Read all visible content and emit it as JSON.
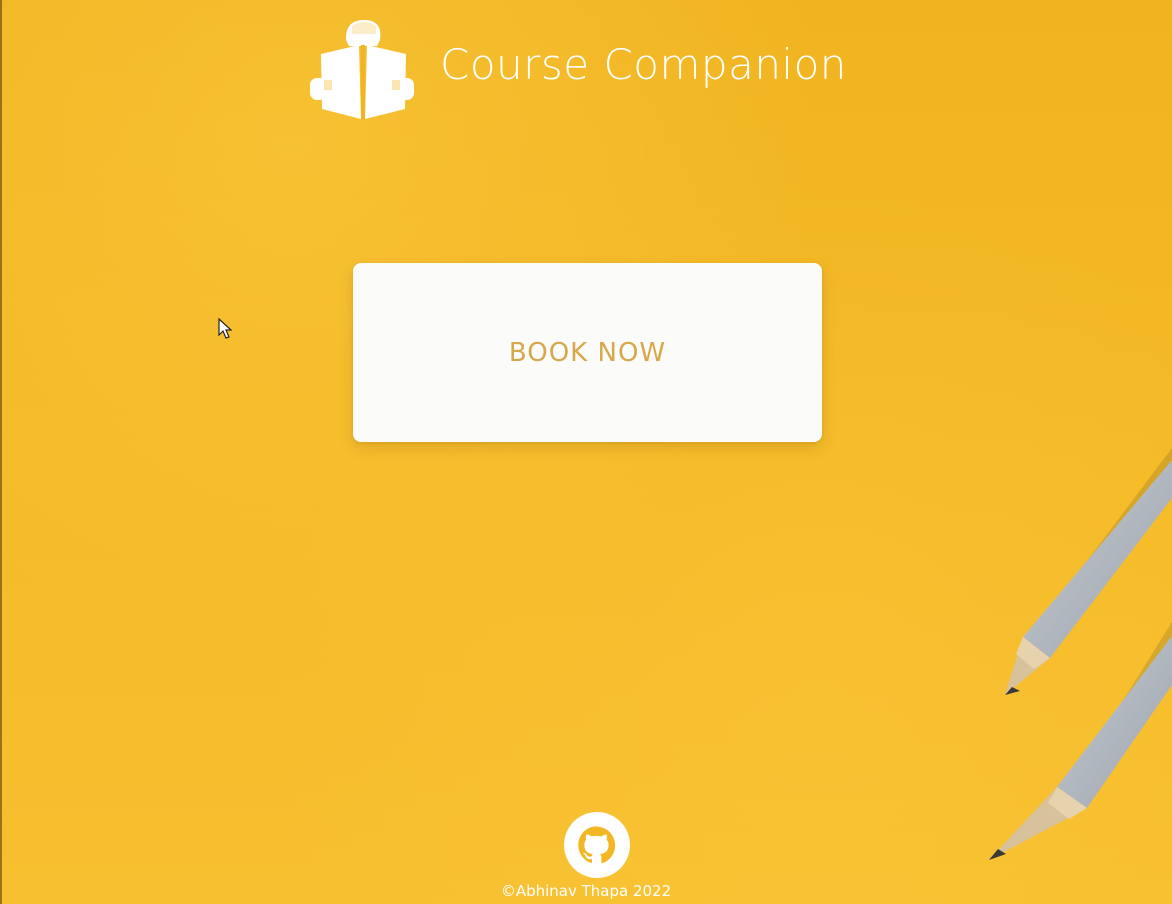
{
  "header": {
    "title": "Course Companion",
    "logo_icon": "reader-book-icon"
  },
  "main": {
    "cta_label": "BOOK NOW"
  },
  "footer": {
    "github_icon": "github-icon",
    "copyright": "©Abhinav Thapa 2022"
  },
  "colors": {
    "background": "#f5ba27",
    "button_background": "#fbfbfa",
    "button_text": "#d7a84a",
    "title_text": "#ffffff"
  }
}
